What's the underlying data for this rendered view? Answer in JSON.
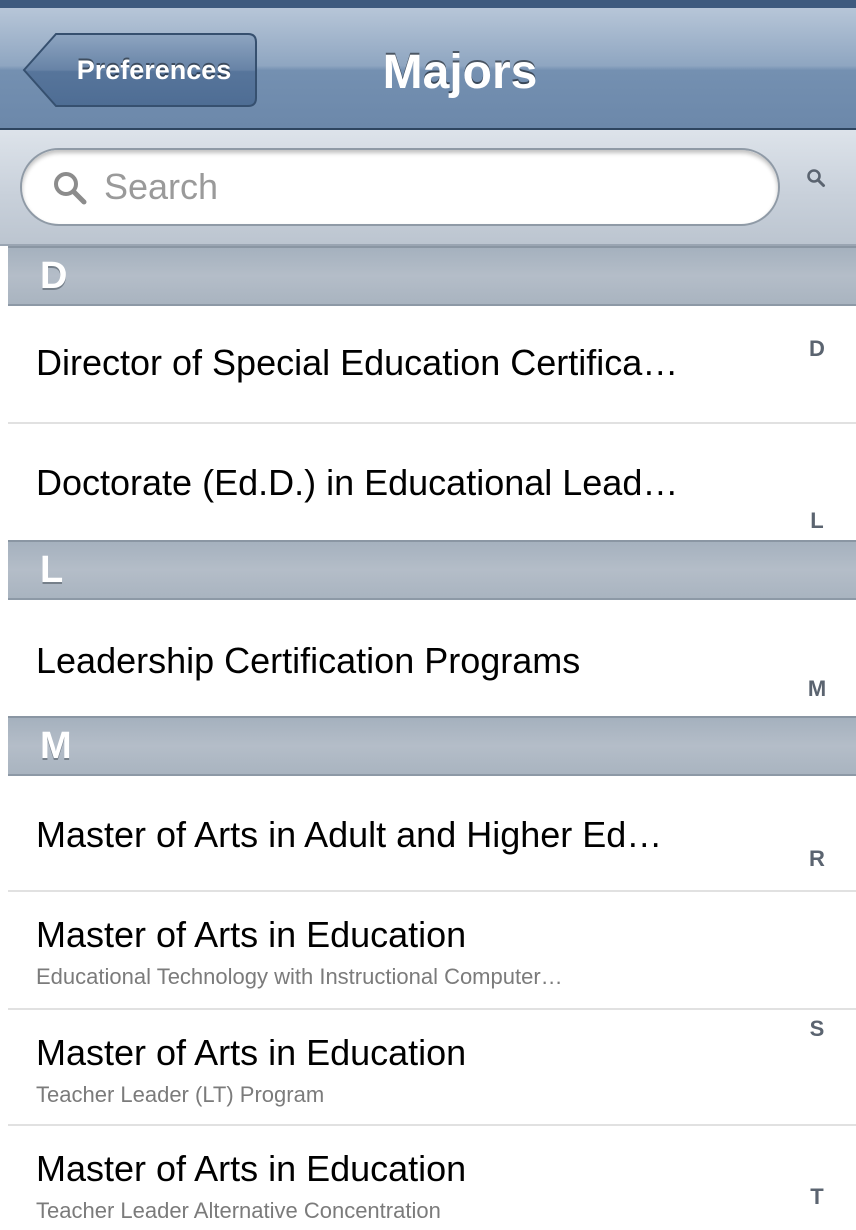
{
  "navbar": {
    "back_label": "Preferences",
    "title": "Majors"
  },
  "search": {
    "placeholder": "Search"
  },
  "sections": [
    {
      "header": "D",
      "rows": [
        {
          "title": "Director of Special Education Certifica…",
          "subtitle": ""
        },
        {
          "title": "Doctorate (Ed.D.) in Educational Lead…",
          "subtitle": ""
        }
      ]
    },
    {
      "header": "L",
      "rows": [
        {
          "title": "Leadership Certification Programs",
          "subtitle": ""
        }
      ]
    },
    {
      "header": "M",
      "rows": [
        {
          "title": "Master of Arts in Adult and Higher Ed…",
          "subtitle": ""
        },
        {
          "title": "Master of Arts in Education",
          "subtitle": "Educational Technology with Instructional Computer…"
        },
        {
          "title": "Master of Arts in Education",
          "subtitle": "Teacher Leader (LT) Program"
        },
        {
          "title": "Master of Arts in Education",
          "subtitle": "Teacher Leader Alternative Concentration"
        }
      ]
    }
  ],
  "index": {
    "search_icon": "magnifier-icon",
    "letters": [
      "D",
      "L",
      "M",
      "R",
      "S",
      "T"
    ]
  },
  "colors": {
    "navbar": "#7490b1",
    "section_header": "#aeb8c4",
    "index_text": "#5b6470"
  }
}
